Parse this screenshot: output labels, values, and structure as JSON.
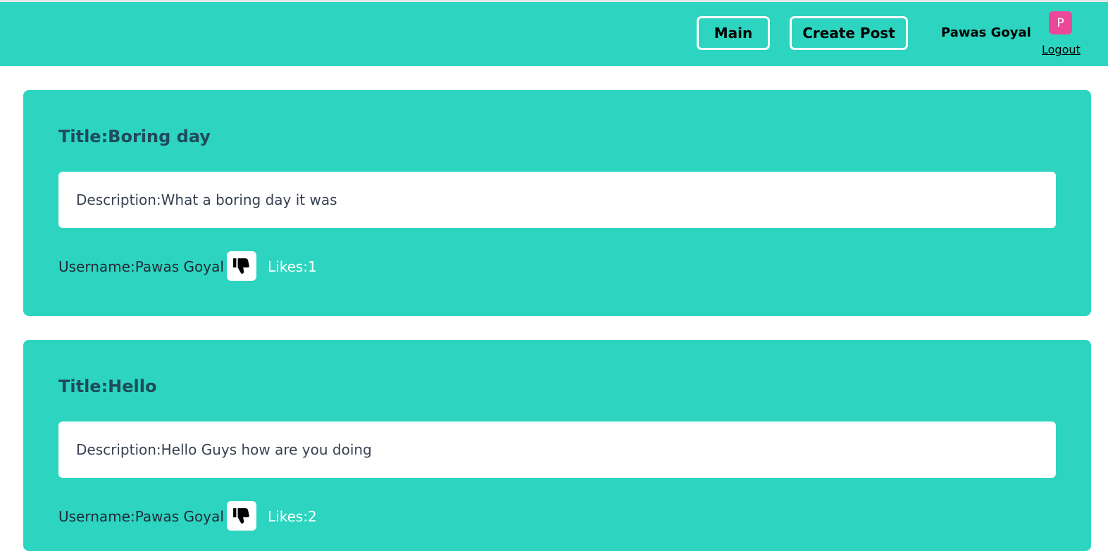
{
  "header": {
    "main_label": "Main",
    "create_post_label": "Create Post",
    "user_name": "Pawas Goyal",
    "avatar_letter": "P",
    "logout_label": "Logout"
  },
  "posts": [
    {
      "title": "Title:Boring day",
      "description": "Description:What a boring day it was",
      "username": "Username:Pawas Goyal",
      "likes": "Likes:1",
      "like_icon": "thumbs-down-icon"
    },
    {
      "title": "Title:Hello",
      "description": "Description:Hello Guys how are you doing",
      "username": "Username:Pawas Goyal",
      "likes": "Likes:2",
      "like_icon": "thumbs-down-icon"
    }
  ],
  "colors": {
    "navbar": "#2dd4bf",
    "card": "#2dd4bf",
    "avatar": "#ec4899",
    "title_text": "#1f4b5a"
  }
}
